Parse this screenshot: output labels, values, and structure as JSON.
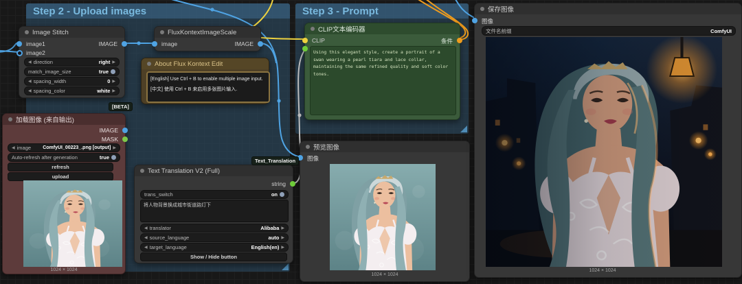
{
  "icons": {
    "arrow_left": "◀",
    "arrow_right": "▶"
  },
  "groups": {
    "step2": {
      "title": "Step 2 - Upload images"
    },
    "step3": {
      "title": "Step 3 - Prompt"
    }
  },
  "badges": {
    "beta": "[BETA]",
    "text_translation": "Text_Translation"
  },
  "nodes": {
    "image_stitch": {
      "title": "Image Stitch",
      "in1": "image1",
      "in2": "image2",
      "out": "IMAGE",
      "widgets": [
        {
          "label": "direction",
          "value": "right"
        },
        {
          "label": "match_image_size",
          "value": "true"
        },
        {
          "label": "spacing_width",
          "value": "0"
        },
        {
          "label": "spacing_color",
          "value": "white"
        }
      ]
    },
    "flux_scale": {
      "title": "FluxKontextImageScale",
      "in": "image",
      "out": "IMAGE"
    },
    "note": {
      "title": "About Flux Kontext Edit",
      "line_en": "[English] Use Ctrl + B to enable multiple image input.",
      "line_zh": "[中文] 使用 Ctrl + B 来启用多张图片输入."
    },
    "load_image": {
      "title": "加载图像 (来自输出)",
      "out1": "IMAGE",
      "out2": "MASK",
      "image_label": "image",
      "image_value": "ComfyUI_00223_.png [output]",
      "autorefresh_label": "Auto-refresh after generation",
      "autorefresh_value": "true",
      "refresh_label": "refresh",
      "upload_label": "upload",
      "caption": "1024 × 1024"
    },
    "text_translation": {
      "title": "Text Translation V2 (Full)",
      "out": "string",
      "switch_label": "trans_switch",
      "switch_value": "on",
      "text": "将人物背景换成城市街道路灯下",
      "widgets": [
        {
          "label": "translator",
          "value": "Alibaba"
        },
        {
          "label": "source_language",
          "value": "auto"
        },
        {
          "label": "target_language",
          "value": "English(en)"
        }
      ],
      "button_label": "Show / Hide button"
    },
    "clip_encode": {
      "title": "CLIP文本编码器",
      "in": "CLIP",
      "out": "条件",
      "text": "Using this elegant style, create a portrait of a swan wearing a pearl tiara and lace collar, maintaining the same refined quality and soft color tones."
    },
    "preview_image": {
      "title": "预览图像",
      "in": "图像",
      "caption": "1024 × 1024"
    },
    "save_image": {
      "title": "保存图像",
      "in": "图像",
      "prefix_label": "文件名前缀",
      "prefix_value": "ComfyUI",
      "caption": "1024 × 1024"
    }
  },
  "colors": {
    "link_image": "#4fa3e3",
    "link_clip": "#eed23f",
    "link_conditioning": "#ef9c1d",
    "link_string": "#bfbfbf",
    "group_title": "#79b9de"
  }
}
